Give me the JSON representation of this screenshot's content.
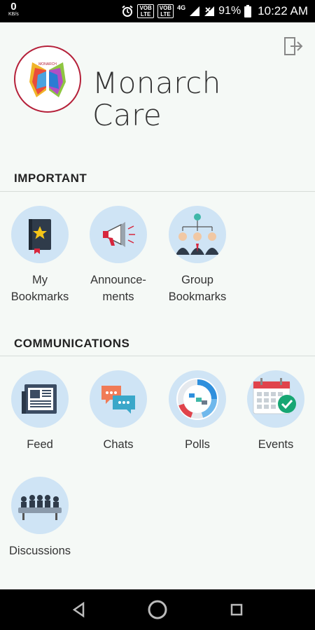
{
  "status_bar": {
    "net_speed": "0",
    "net_unit": "KB/s",
    "sim1": "VOB",
    "sim1_sub": "LTE",
    "sim2": "VOB",
    "sim2_sub": "LTE",
    "network": "4G",
    "battery": "91%",
    "time": "10:22 AM"
  },
  "header": {
    "logo_text": "MONARCH",
    "title_line1": "Monarch",
    "title_line2": "Care"
  },
  "sections": {
    "important": {
      "title": "IMPORTANT",
      "items": [
        {
          "label": "My\nBookmarks",
          "icon": "bookmark-book-icon"
        },
        {
          "label": "Announce-\nments",
          "icon": "megaphone-icon"
        },
        {
          "label": "Group\nBookmarks",
          "icon": "group-people-icon"
        }
      ]
    },
    "communications": {
      "title": "COMMUNICATIONS",
      "items": [
        {
          "label": "Feed",
          "icon": "newspaper-icon"
        },
        {
          "label": "Chats",
          "icon": "chat-bubbles-icon"
        },
        {
          "label": "Polls",
          "icon": "poll-donut-icon"
        },
        {
          "label": "Events",
          "icon": "calendar-check-icon"
        },
        {
          "label": "Discussions",
          "icon": "meeting-table-icon"
        }
      ]
    }
  },
  "colors": {
    "background": "#f5f9f6",
    "icon_circle": "#cfe4f5",
    "logo_ring": "#b5213a"
  }
}
